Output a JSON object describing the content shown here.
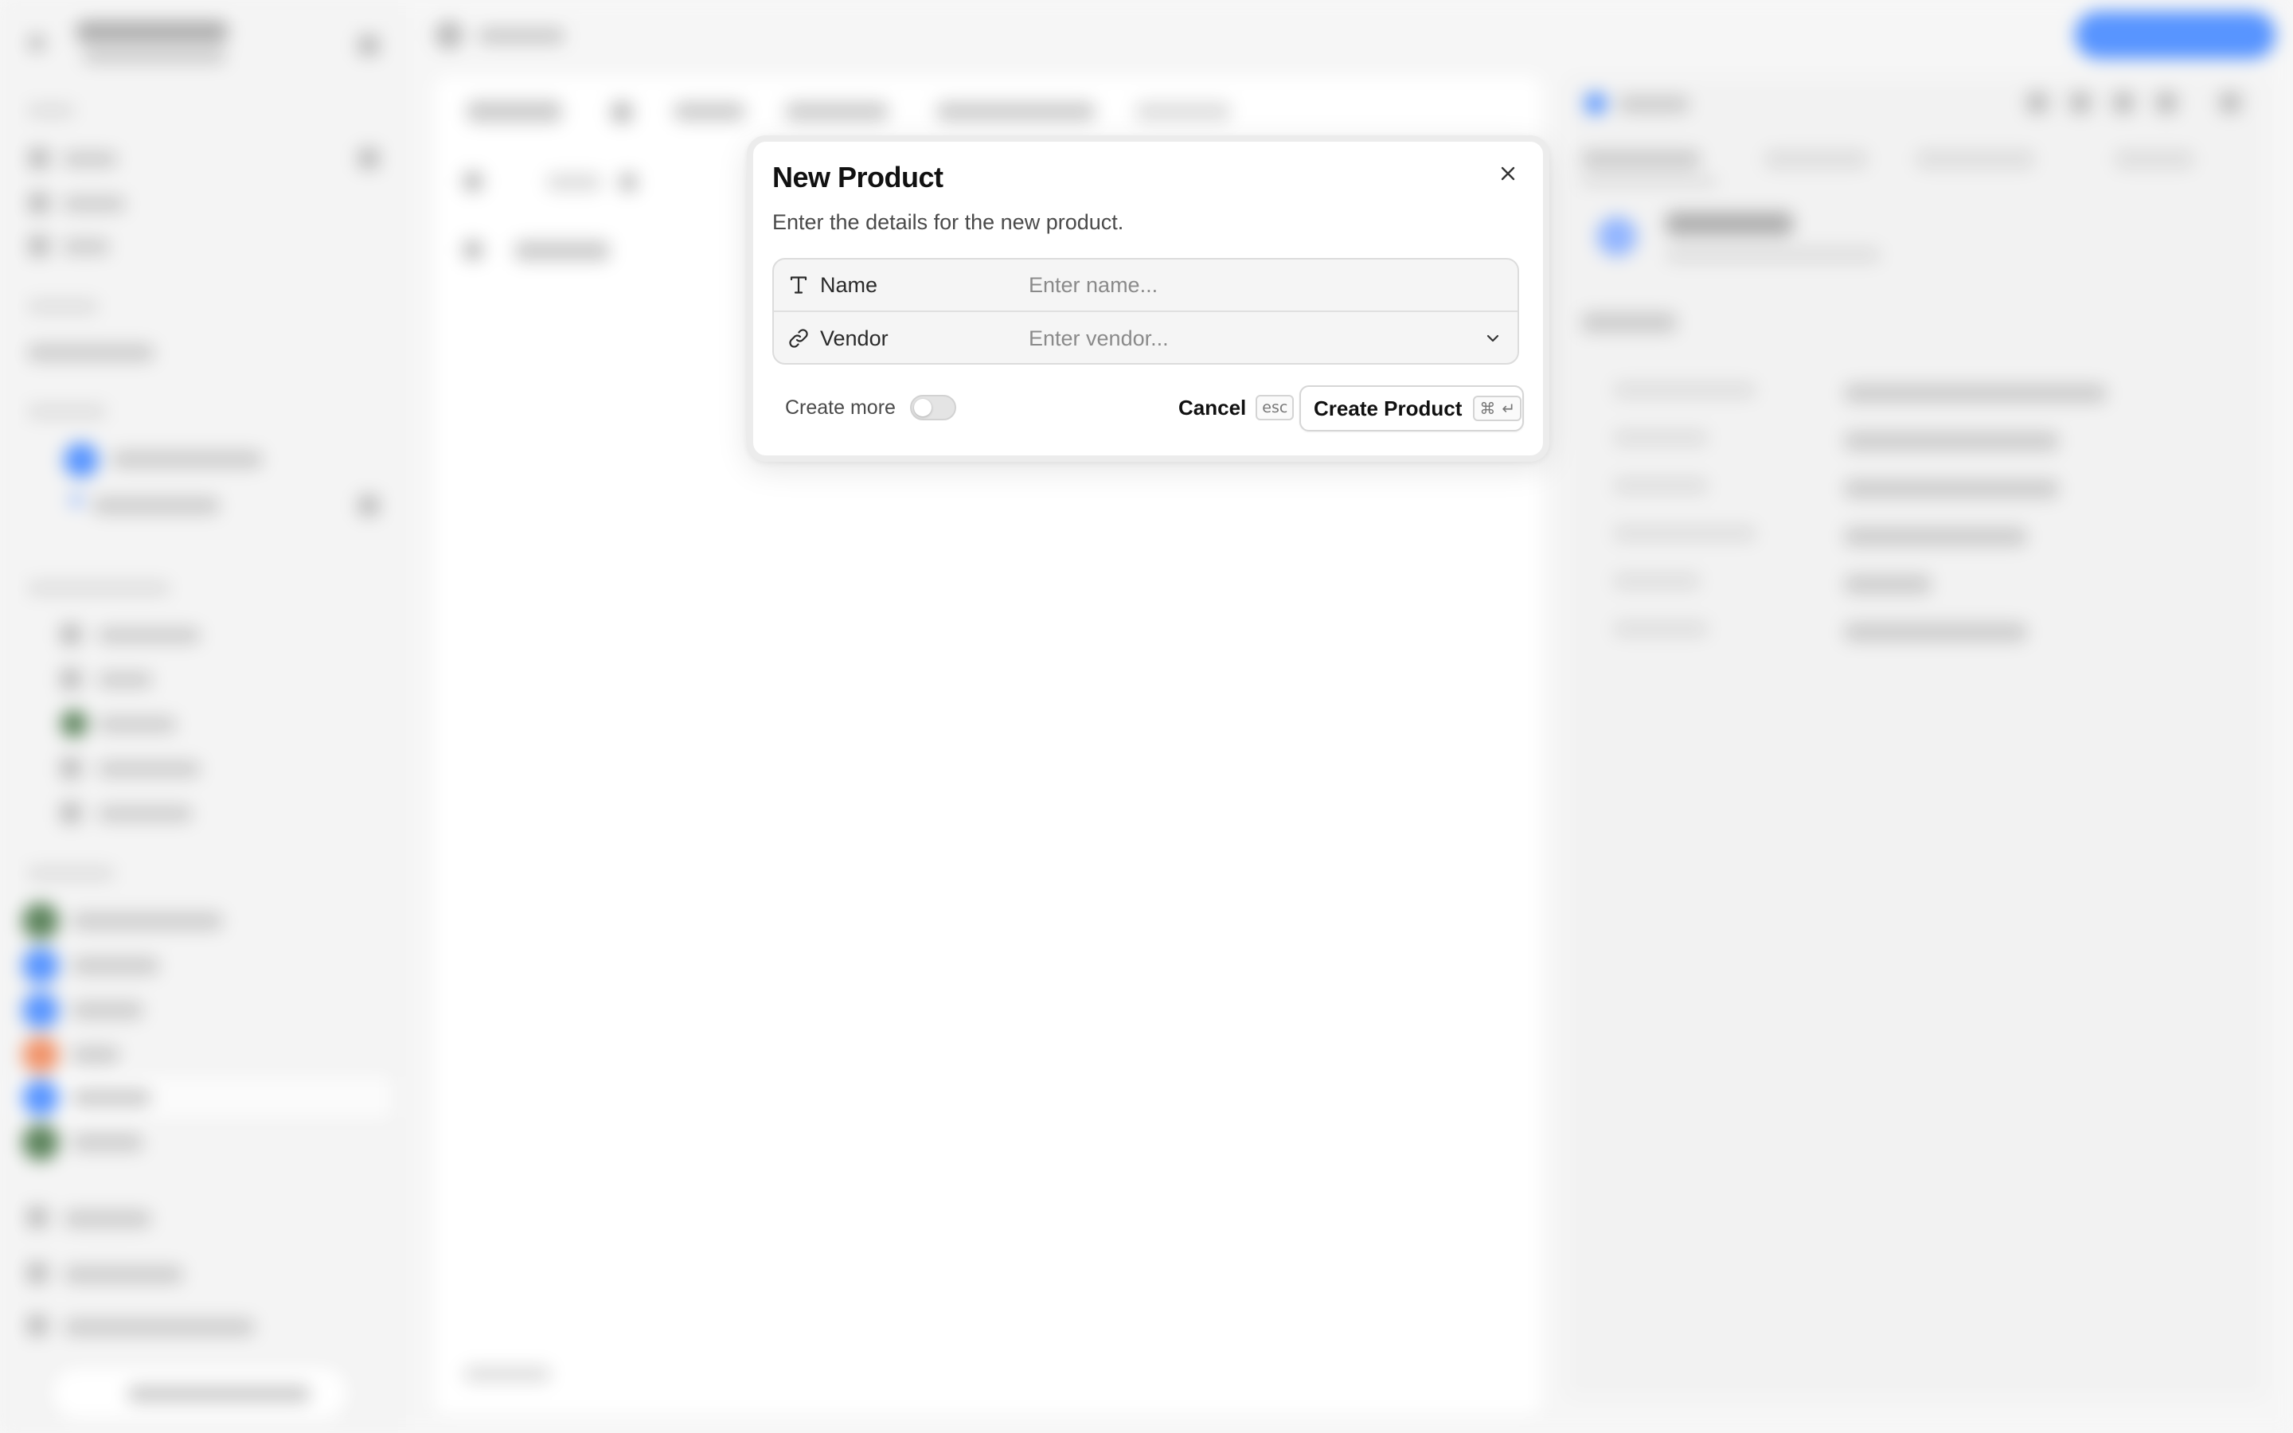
{
  "dialog": {
    "title": "New Product",
    "subtitle": "Enter the details for the new product.",
    "close_icon": "close-icon",
    "fields": [
      {
        "label": "Name",
        "placeholder": "Enter name...",
        "value": "",
        "icon": "text-type-icon"
      },
      {
        "label": "Vendor",
        "placeholder": "Enter vendor...",
        "value": "",
        "icon": "link-icon",
        "dropdown_icon": "chevron-down-icon"
      }
    ],
    "create_more": {
      "label": "Create more",
      "enabled": false
    },
    "cancel": {
      "label": "Cancel",
      "shortcut": "esc"
    },
    "submit": {
      "label": "Create Product",
      "shortcut_keys": [
        "⌘",
        "↵"
      ]
    }
  },
  "colors": {
    "primary_accent": "#4a8cff",
    "avatar_orange": "#f08a5d",
    "avatar_green": "#4f7a4f"
  }
}
